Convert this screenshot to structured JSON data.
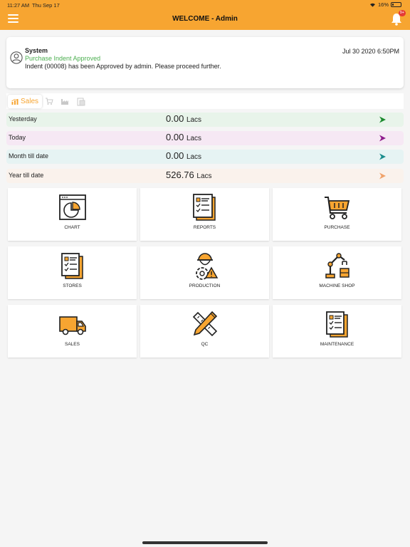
{
  "status_bar": {
    "time": "11:27 AM",
    "date": "Thu Sep 17",
    "battery": "16%",
    "battery_level": 0.16
  },
  "header": {
    "title": "WELCOME - Admin",
    "badge": "9+"
  },
  "notification": {
    "sender": "System",
    "subject": "Purchase Indent Approved",
    "body": "Indent (00008) has been Approved by admin. Please proceed further.",
    "datetime": "Jul 30 2020  6:50PM"
  },
  "tabs": [
    {
      "label": "Sales",
      "icon": "bar-chart-icon",
      "active": true
    },
    {
      "icon": "cart-icon"
    },
    {
      "icon": "factory-icon"
    },
    {
      "icon": "document-icon"
    }
  ],
  "summary_rows": [
    {
      "label": "Yesterday",
      "value": "0.00",
      "unit": "Lacs",
      "bg": "#e8f4ea",
      "arrow_color": "#1b8a2e"
    },
    {
      "label": "Today",
      "value": "0.00",
      "unit": "Lacs",
      "bg": "#f6e8f4",
      "arrow_color": "#8e1b8c"
    },
    {
      "label": "Month till date",
      "value": "0.00",
      "unit": "Lacs",
      "bg": "#e6f3f3",
      "arrow_color": "#1a8c8c"
    },
    {
      "label": "Year till date",
      "value": "526.76",
      "unit": "Lacs",
      "bg": "#faf2ec",
      "arrow_color": "#f0a26a"
    }
  ],
  "modules": [
    {
      "label": "CHART",
      "icon": "pie-chart-icon"
    },
    {
      "label": "REPORTS",
      "icon": "report-icon"
    },
    {
      "label": "PURCHASE",
      "icon": "shopping-cart-icon"
    },
    {
      "label": "STORES",
      "icon": "checklist-icon"
    },
    {
      "label": "PRODUCTION",
      "icon": "worker-gear-icon"
    },
    {
      "label": "MACHINE SHOP",
      "icon": "robot-arm-icon"
    },
    {
      "label": "SALES",
      "icon": "delivery-truck-icon"
    },
    {
      "label": "QC",
      "icon": "ruler-pencil-icon"
    },
    {
      "label": "MAINTENANCE",
      "icon": "clipboard-icon"
    }
  ],
  "colors": {
    "accent": "#f7a531",
    "badge": "#e53935",
    "success_text": "#4caf50"
  }
}
